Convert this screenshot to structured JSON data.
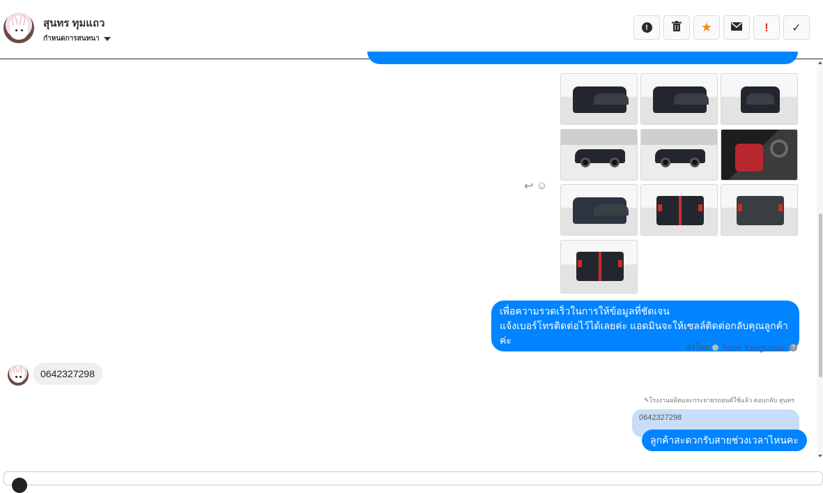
{
  "header": {
    "contact_name": "สุนทร ทุมแถว",
    "subtitle": "กำหนดการสนทนา",
    "actions": [
      {
        "name": "report-button",
        "icon": "alert-circle-icon",
        "glyph": "!"
      },
      {
        "name": "delete-button",
        "icon": "trash-icon",
        "glyph": "🗑"
      },
      {
        "name": "star-button",
        "icon": "star-icon",
        "glyph": "★"
      },
      {
        "name": "mail-button",
        "icon": "envelope-icon",
        "glyph": "✉"
      },
      {
        "name": "spam-button",
        "icon": "exclamation-icon",
        "glyph": "!"
      },
      {
        "name": "done-button",
        "icon": "check-icon",
        "glyph": "✓"
      }
    ]
  },
  "messages": {
    "outgoing_text": {
      "line1": "เพื่อความรวดเร็วในการให้ข้อมูลที่ชัดเจน",
      "line2": "แจ้งเบอร์โทรติดต่อไว้ได้เลยค่ะ แอดมินจะให้เซลล์ติดต่อกลับคุณลูกค้าค่ะ"
    },
    "sent_by_label": "ส่งโดย",
    "sent_by_name": "Toom Kangsadan",
    "help_glyph": "?",
    "incoming_text": "0642327298",
    "reply_note": "โรงงานผลิตและกระจายรถยนต์ใช้แล้ว ตอบกลับ สุนทร",
    "reply_note_glyph": "✎",
    "quoted_text": "0642327298",
    "reply_text": "ลูกค้าสะดวกรับสายช่วงเวลาไหนคะ"
  },
  "tools": {
    "reply_glyph": "↩",
    "emoji_glyph": "☺"
  },
  "colors": {
    "messenger_blue": "#0084ff",
    "incoming_bubble": "#efefef",
    "quote_bubble": "#c8ddf7",
    "star_orange": "#f08a24",
    "spam_red": "#e0311f"
  }
}
